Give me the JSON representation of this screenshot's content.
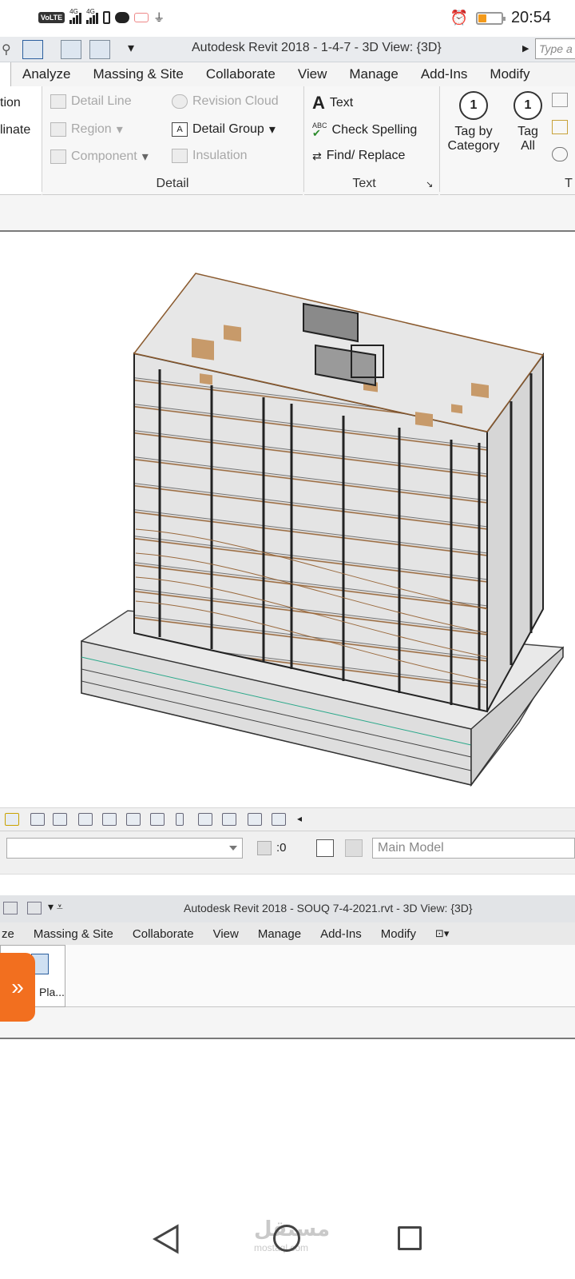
{
  "status_bar": {
    "volte": "VoLTE",
    "net1": "4G",
    "net2": "4G",
    "time": "20:54",
    "battery_level": 0.35
  },
  "revit_top": {
    "window_title": "Autodesk Revit 2018 -    1-4-7 - 3D View: {3D}",
    "search_placeholder": "Type a",
    "tabs": [
      "Analyze",
      "Massing & Site",
      "Collaborate",
      "View",
      "Manage",
      "Add-Ins",
      "Modify"
    ],
    "partial_left": {
      "line1": "tion",
      "line2": "linate"
    },
    "detail_panel": {
      "detail_line": "Detail  Line",
      "revision_cloud": "Revision  Cloud",
      "region": "Region",
      "detail_group": "Detail  Group",
      "component": "Component",
      "insulation": "Insulation",
      "label": "Detail"
    },
    "text_panel": {
      "text": "Text",
      "check_spelling": "Check  Spelling",
      "find_replace": "Find/  Replace",
      "label": "Text",
      "abc": "ABC"
    },
    "tag_panel": {
      "tag_by_category_1": "Tag by",
      "tag_by_category_2": "Category",
      "tag_all_1": "Tag",
      "tag_all_2": "All",
      "tag_num": "1",
      "label_partial": "T"
    }
  },
  "statusbar": {
    "zero_label": ":0",
    "model": "Main Model"
  },
  "revit_bottom": {
    "window_title": "Autodesk Revit 2018 -    SOUQ 7-4-2021.rvt - 3D View: {3D}",
    "tabs": [
      "ze",
      "Massing & Site",
      "Collaborate",
      "View",
      "Manage",
      "Add-Ins",
      "Modify"
    ],
    "plan_button": "Pla...",
    "drawer_icon": "»"
  },
  "watermark": {
    "ar": "مستقل",
    "en": "mostaql.com"
  },
  "colors": {
    "accent": "#f26f1f",
    "ribbon": "#f5f5f5",
    "model_gray": "#e3e3e3",
    "slab_edge": "#b07a4a"
  }
}
